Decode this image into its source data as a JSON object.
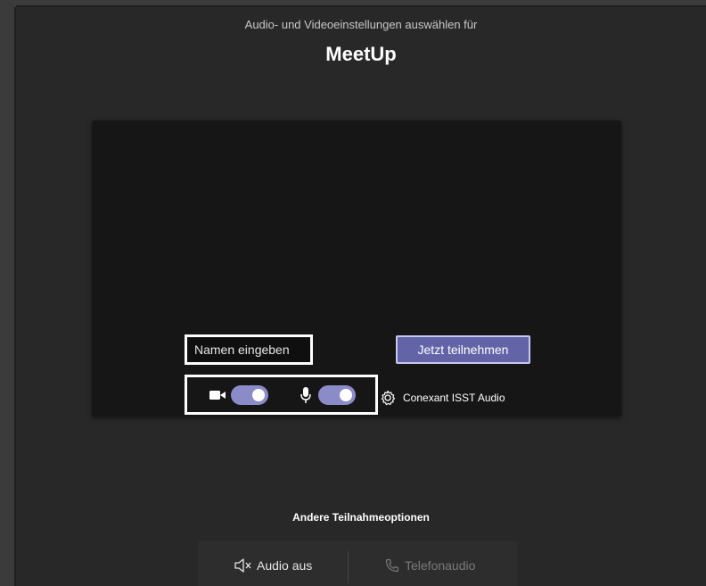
{
  "header": {
    "subtitle": "Audio- und Videoeinstellungen auswählen für",
    "meeting_title": "MeetUp"
  },
  "join": {
    "name_placeholder": "Namen eingeben",
    "join_button_label": "Jetzt teilnehmen"
  },
  "devices": {
    "video_on": true,
    "audio_on": true,
    "audio_device_label": "Conexant ISST Audio"
  },
  "other_options": {
    "heading": "Andere Teilnahmeoptionen",
    "audio_off_label": "Audio aus",
    "phone_audio_label": "Telefonaudio"
  },
  "colors": {
    "accent": "#6264a7",
    "toggle_on": "#8b8cc7",
    "background": "#282828"
  }
}
